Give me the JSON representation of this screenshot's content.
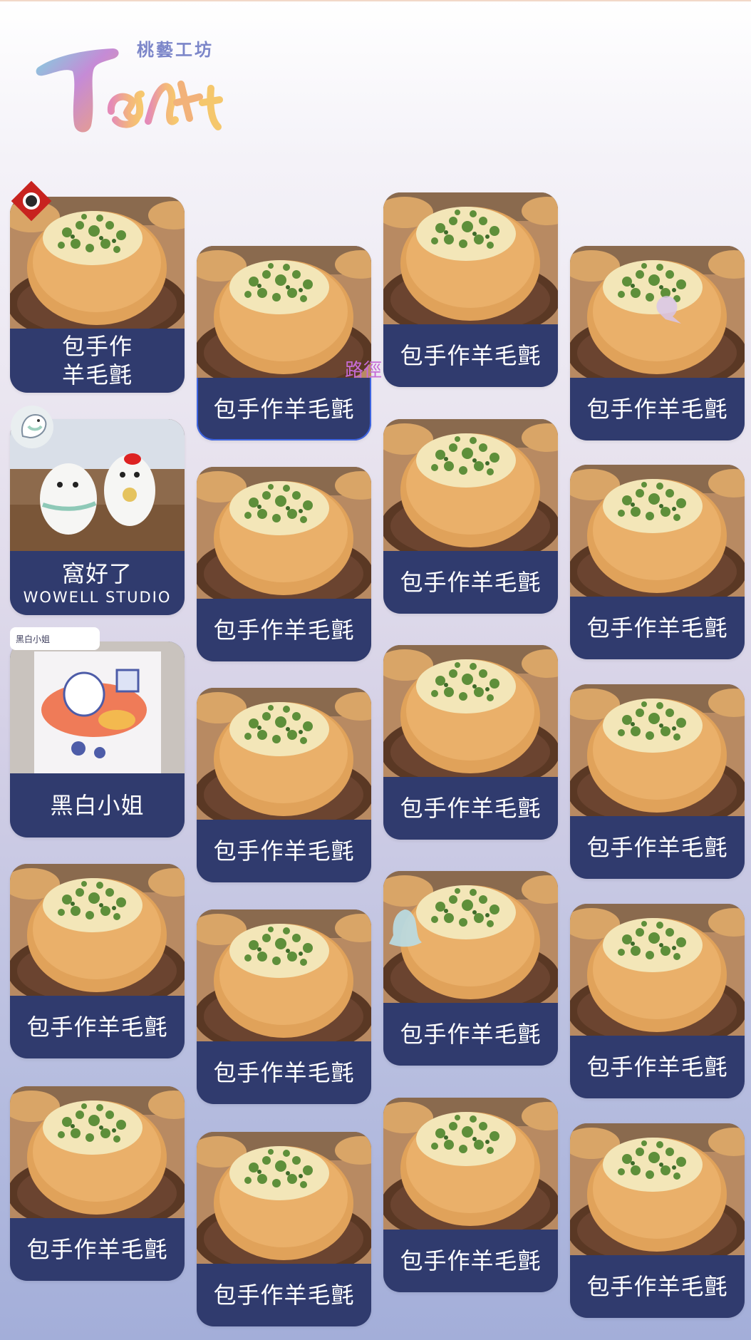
{
  "logo": {
    "subtitle": "桃藝工坊",
    "wordmark": "TArt"
  },
  "overlay": {
    "path_label": "路徑"
  },
  "cards": [
    {
      "id": "c1",
      "title": "包手作",
      "title2": "羊毛氈",
      "image": "bread"
    },
    {
      "id": "c2",
      "title": "包手作羊毛氈",
      "image": "bread",
      "selected": true
    },
    {
      "id": "c3",
      "title": "包手作羊毛氈",
      "image": "bread"
    },
    {
      "id": "c4",
      "title": "包手作羊毛氈",
      "image": "bread"
    },
    {
      "id": "c5",
      "title": "窩好了",
      "subtitle": "WOWELL STUDIO",
      "image": "figurines"
    },
    {
      "id": "c6",
      "title": "包手作羊毛氈",
      "image": "bread"
    },
    {
      "id": "c7",
      "title": "包手作羊毛氈",
      "image": "bread"
    },
    {
      "id": "c8",
      "title": "包手作羊毛氈",
      "image": "bread"
    },
    {
      "id": "c9",
      "title": "黑白小姐",
      "image": "illustration",
      "badge": "黑白小姐"
    },
    {
      "id": "c10",
      "title": "包手作羊毛氈",
      "image": "bread"
    },
    {
      "id": "c11",
      "title": "包手作羊毛氈",
      "image": "bread"
    },
    {
      "id": "c12",
      "title": "包手作羊毛氈",
      "image": "bread"
    },
    {
      "id": "c13",
      "title": "包手作羊毛氈",
      "image": "bread"
    },
    {
      "id": "c14",
      "title": "包手作羊毛氈",
      "image": "bread"
    },
    {
      "id": "c15",
      "title": "包手作羊毛氈",
      "image": "bread"
    },
    {
      "id": "c16",
      "title": "包手作羊毛氈",
      "image": "bread"
    },
    {
      "id": "c17",
      "title": "包手作羊毛氈",
      "image": "bread"
    },
    {
      "id": "c18",
      "title": "包手作羊毛氈",
      "image": "bread"
    },
    {
      "id": "c19",
      "title": "包手作羊毛氈",
      "image": "bread"
    },
    {
      "id": "c20",
      "title": "包手作羊毛氈",
      "image": "bread"
    }
  ],
  "colors": {
    "label_bg": "#303b6e",
    "accent": "#3e64e0",
    "path_label": "#c66bd6"
  }
}
